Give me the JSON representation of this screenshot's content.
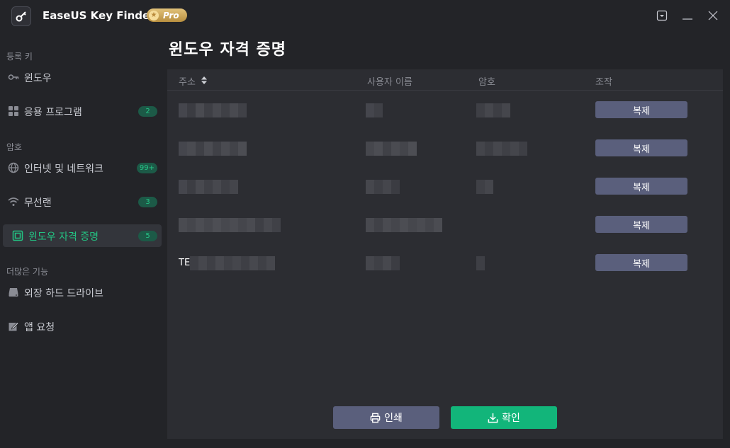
{
  "app": {
    "title": "EaseUS Key Finder",
    "pro_label": "Pro"
  },
  "window_controls": [
    "menu-icon",
    "minimize-icon",
    "close-icon"
  ],
  "sidebar": {
    "sections": [
      {
        "label": "등록 키"
      },
      {
        "label": "암호"
      },
      {
        "label": "더많은 기능"
      }
    ],
    "items": [
      {
        "label": "윈도우",
        "icon": "key-icon"
      },
      {
        "label": "응용 프로그램",
        "icon": "apps-grid-icon",
        "badge": "2"
      },
      {
        "label": "인터넷 및 네트워크",
        "icon": "globe-icon",
        "badge": "99+"
      },
      {
        "label": "무선랜",
        "icon": "wifi-icon",
        "badge": "3"
      },
      {
        "label": "윈도우 자격 증명",
        "icon": "credential-icon",
        "badge": "5",
        "active": true
      },
      {
        "label": "외장 하드 드라이브",
        "icon": "drive-icon"
      },
      {
        "label": "앱 요청",
        "icon": "edit-icon"
      }
    ]
  },
  "main": {
    "title": "윈도우 자격 증명",
    "table": {
      "columns": [
        "주소",
        "사용자 이름",
        "암호",
        "조작"
      ],
      "rows": [
        {
          "address": "",
          "username": "",
          "password": "",
          "action": "복제"
        },
        {
          "address": "",
          "username": "",
          "password": "",
          "action": "복제"
        },
        {
          "address": "",
          "username": "",
          "password": "",
          "action": "복제"
        },
        {
          "address": "",
          "username": "",
          "password": "",
          "action": "복제"
        },
        {
          "address": "TE",
          "username": "",
          "password": "",
          "action": "복제"
        }
      ]
    },
    "buttons": {
      "print": "인쇄",
      "confirm": "확인"
    }
  },
  "colors": {
    "background": "#232428",
    "panel": "#2c2d32",
    "accent_green": "#12b57a",
    "button_slate": "#5a5f7c",
    "badge_bg": "#1c5a47"
  }
}
